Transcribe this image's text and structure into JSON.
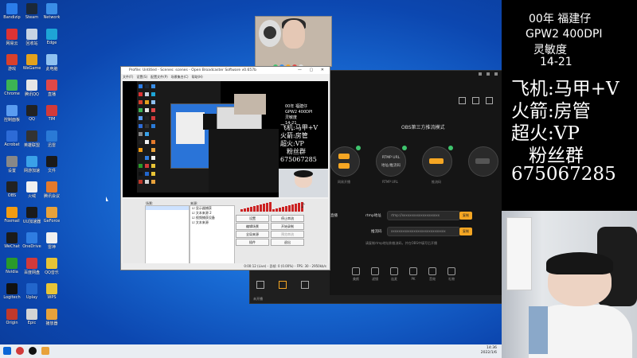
{
  "desktop_icons": [
    {
      "label": "Bandizip",
      "color": "#2b7de9"
    },
    {
      "label": "Steam",
      "color": "#1b2838"
    },
    {
      "label": "Network",
      "color": "#3a8ee6"
    },
    {
      "label": "网易云",
      "color": "#d33"
    },
    {
      "label": "回收站",
      "color": "#c7d3e3"
    },
    {
      "label": "Edge",
      "color": "#1ea5d6"
    },
    {
      "label": "游戏",
      "color": "#d8402b"
    },
    {
      "label": "WeGame",
      "color": "#e4a21d"
    },
    {
      "label": "此电脑",
      "color": "#8fc1f0"
    },
    {
      "label": "Chrome",
      "color": "#3cb354"
    },
    {
      "label": "腾讯QQ",
      "color": "#e6e6e6"
    },
    {
      "label": "直播",
      "color": "#e04848"
    },
    {
      "label": "控制面板",
      "color": "#5a9cf0"
    },
    {
      "label": "QQ",
      "color": "#222"
    },
    {
      "label": "TIM",
      "color": "#d23a3a"
    },
    {
      "label": "Acrobat",
      "color": "#2d6bd7"
    },
    {
      "label": "英雄联盟",
      "color": "#333"
    },
    {
      "label": "迅雷",
      "color": "#2a7ad6"
    },
    {
      "label": "设置",
      "color": "#888"
    },
    {
      "label": "网游加速",
      "color": "#3aa1e8"
    },
    {
      "label": "文件",
      "color": "#1a1a1a"
    },
    {
      "label": "OBS",
      "color": "#222"
    },
    {
      "label": "火绒",
      "color": "#f0f0f0"
    },
    {
      "label": "腾讯会议",
      "color": "#e57a2b"
    },
    {
      "label": "Foxmail",
      "color": "#f39c12"
    },
    {
      "label": "UU加速器",
      "color": "#1a1a1a"
    },
    {
      "label": "GeForce",
      "color": "#e8a23b"
    },
    {
      "label": "WeChat",
      "color": "#1b1b1b"
    },
    {
      "label": "OneDrive",
      "color": "#2f7de1"
    },
    {
      "label": "雷神",
      "color": "#f0f0f0"
    },
    {
      "label": "Nvidia",
      "color": "#2a9a2a"
    },
    {
      "label": "百度网盘",
      "color": "#d23a3a"
    },
    {
      "label": "QQ音乐",
      "color": "#e8c436"
    },
    {
      "label": "Logitech",
      "color": "#111"
    },
    {
      "label": "Uplay",
      "color": "#2266cc"
    },
    {
      "label": "WPS",
      "color": "#e8c436"
    },
    {
      "label": "Origin",
      "color": "#c0392b"
    },
    {
      "label": "Epic",
      "color": "#d4d4d4"
    },
    {
      "label": "播放器",
      "color": "#e8a23b"
    }
  ],
  "obs": {
    "title": "Profile: Untitled - Scenes: scenes - Open Broadcaster Software v0.657b",
    "menu": [
      "文件(F)",
      "设置(S)",
      "配置文件(P)",
      "场景集合(C)",
      "帮助(H)"
    ],
    "scenes_label": "场景:",
    "sources_label": "来源:",
    "sources": [
      "显示器捕获",
      "文本来源 2",
      "视频捕获设备",
      "文本来源"
    ],
    "buttons": {
      "settings": "设置",
      "start_stream": "停止串流",
      "edit_scene": "编辑场景",
      "start_recording": "开始录制",
      "global_sources": "全局来源",
      "preview": "预览串流",
      "plugins": "插件",
      "exit": "退出"
    },
    "status": "0:00:12 (Live) - 丢帧: 0 (0.00%) - FPS: 30 - 2950kb/s"
  },
  "app": {
    "title": "OBS第三方推流模式",
    "nodes": [
      {
        "label": "网易开播"
      },
      {
        "label": "RTMP URL"
      },
      {
        "label": "推流码"
      }
    ],
    "node_center_text": "RTMP URL",
    "node_center_sub": "地址/推流码",
    "rtmp_label": "rtmp地址",
    "key_label": "推流码",
    "rtmp_value": "rtmp://xxxxxxxxxxxxxxxxxxxx",
    "key_value": "xxxxxxxxxxxxxxxxxxxxxxxxxxxxx",
    "copy": "复制",
    "hint": "请复制rtmp地址和推流码，并在OBS中填写后开播",
    "start_label": "开始直播",
    "bottom_status": "未开播",
    "tools": [
      "美颜",
      "滤镜",
      "连麦",
      "PK",
      "音效",
      "礼物"
    ]
  },
  "overlay": {
    "line1": "00年 福建仔",
    "line2": "GPW2 400DPI",
    "line3": "灵敏度",
    "line4": "14-21",
    "line5": "飞机:马甲+V",
    "line6": "火箭:房管",
    "line7": "超火:VP",
    "line8": "粉丝群",
    "line9": "675067285"
  },
  "taskbar": {
    "time": "14:36",
    "date": "2022/1/6"
  },
  "colors": {
    "accent": "#f5a623",
    "overlay_bg": "#000000",
    "desktop": "#1a6fd8"
  }
}
